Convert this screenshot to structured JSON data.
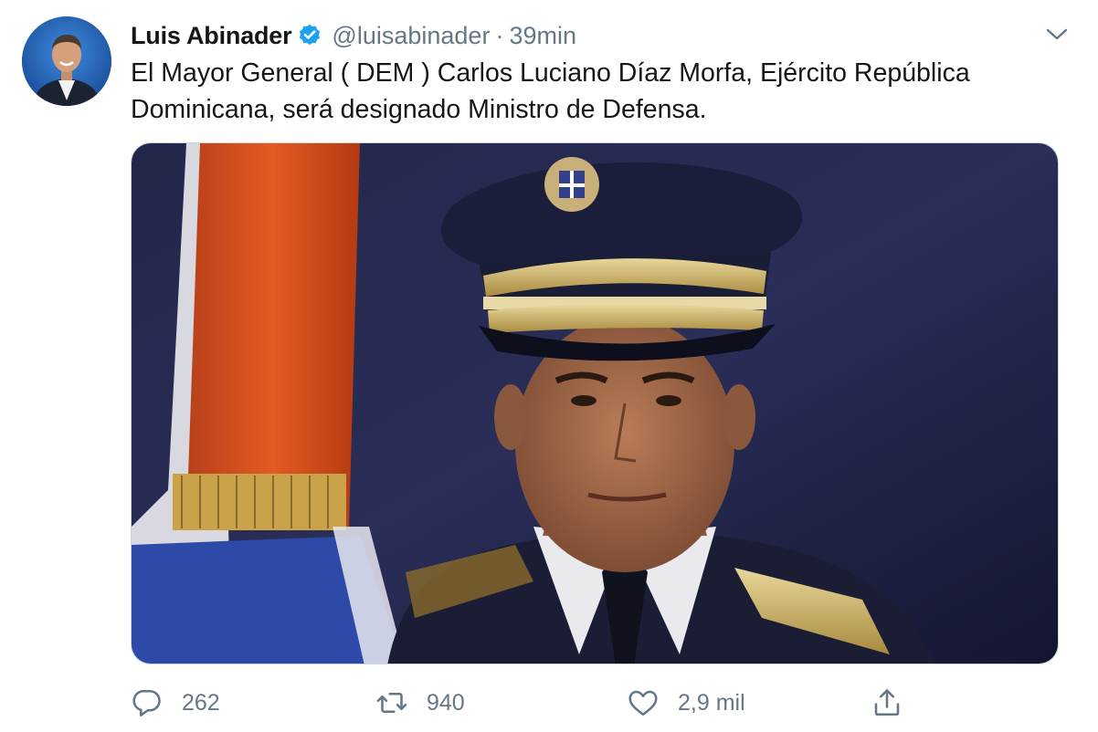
{
  "tweet": {
    "author_name": "Luis Abinader",
    "handle": "@luisabinader",
    "separator": "·",
    "time": "39min",
    "text": "El Mayor General ( DEM ) Carlos Luciano Díaz Morfa, Ejército República Dominicana, será designado Ministro de Defensa.",
    "verified": true
  },
  "actions": {
    "replies": "262",
    "retweets": "940",
    "likes": "2,9 mil"
  },
  "icons": {
    "verified": "verified-badge-icon",
    "more": "chevron-down-icon",
    "reply": "comment-icon",
    "retweet": "retweet-icon",
    "like": "heart-icon",
    "share": "share-icon"
  },
  "colors": {
    "verified_blue": "#1da1f2",
    "secondary_text": "#657786",
    "primary_text": "#14171a"
  }
}
